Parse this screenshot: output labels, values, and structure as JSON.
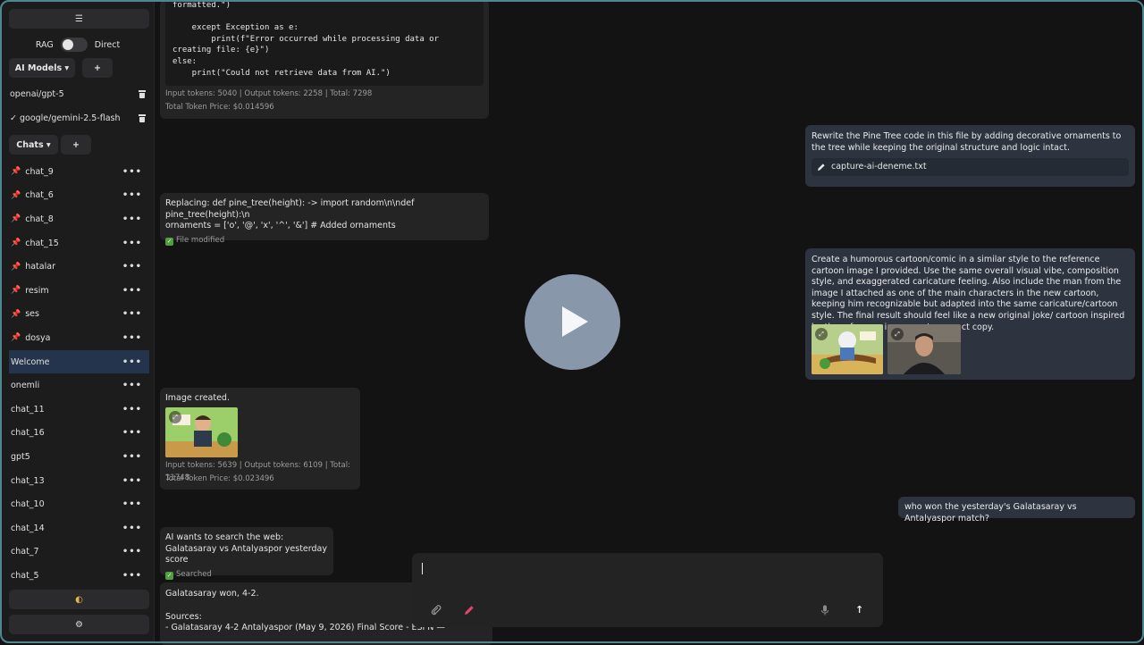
{
  "sidebar": {
    "menu_icon": "☰",
    "toggle_left": "RAG",
    "toggle_right": "Direct",
    "ai_models_label": "AI Models ▾",
    "add_model_label": "+",
    "models": [
      {
        "name": "openai/gpt-5",
        "selected": false
      },
      {
        "name": "✓ google/gemini-2.5-flash",
        "selected": true
      }
    ],
    "chats_label": "Chats ▾",
    "add_chat_label": "+",
    "chats": [
      {
        "name": "chat_9",
        "pinned": true
      },
      {
        "name": "chat_6",
        "pinned": true
      },
      {
        "name": "chat_8",
        "pinned": true
      },
      {
        "name": "chat_15",
        "pinned": true
      },
      {
        "name": "hatalar",
        "pinned": true
      },
      {
        "name": "resim",
        "pinned": true
      },
      {
        "name": "ses",
        "pinned": true
      },
      {
        "name": "dosya",
        "pinned": true
      },
      {
        "name": "Welcome",
        "pinned": false,
        "active": true
      },
      {
        "name": "onemli",
        "pinned": false
      },
      {
        "name": "chat_11",
        "pinned": false
      },
      {
        "name": "chat_16",
        "pinned": false
      },
      {
        "name": "gpt5",
        "pinned": false
      },
      {
        "name": "chat_13",
        "pinned": false
      },
      {
        "name": "chat_10",
        "pinned": false
      },
      {
        "name": "chat_14",
        "pinned": false
      },
      {
        "name": "chat_7",
        "pinned": false
      },
      {
        "name": "chat_5",
        "pinned": false
      }
    ],
    "more_label": "•••",
    "theme_icon": "◐",
    "settings_icon": "⚙"
  },
  "messages": {
    "m1": {
      "code": "formatted.\")\n\n    except Exception as e:\n        print(f\"Error occurred while processing data or\ncreating file: {e}\")\nelse:\n    print(\"Could not retrieve data from AI.\")",
      "tokens": "Input tokens: 5040 | Output tokens: 2258 | Total: 7298",
      "price": "Total Token Price: $0.014596"
    },
    "m2": {
      "text": "Rewrite the Pine Tree code in this file by adding decorative ornaments to the tree while keeping the original structure and logic intact.",
      "attachment": "capture-ai-deneme.txt"
    },
    "m3": {
      "line1": "Replacing: def pine_tree(height):  ->  import random\\n\\ndef pine_tree(height):\\n",
      "line2": "ornaments = ['o', '@', 'x', '^', '&'] # Added ornaments",
      "status": "File modified"
    },
    "m4": {
      "text": "Create a humorous cartoon/comic in a similar style to the reference cartoon image I provided. Use the same overall visual vibe, composition style, and exaggerated caricature feeling. Also include the man from the image I attached as one of the main characters in the new cartoon, keeping him recognizable but adapted into the same caricature/cartoon style. The final result should feel like a new original joke/ cartoon inspired by the reference image, not an exact copy."
    },
    "m5": {
      "text": "Image created.",
      "tokens": "Input tokens: 5639 | Output tokens: 6109 | Total: 11748",
      "price": "Total Token Price: $0.023496"
    },
    "m6": {
      "text": "who won the yesterday's Galatasaray vs Antalyaspor match?"
    },
    "m7": {
      "line1": "AI wants to search the web:",
      "line2": "Galatasaray vs Antalyaspor yesterday score",
      "status": "Searched"
    },
    "m8": {
      "line1": "Galatasaray won, 4-2.",
      "line2": "Sources:",
      "line3": "- Galatasaray 4-2 Antalyaspor (May 9, 2026) Final Score - ESPN —"
    }
  },
  "composer": {
    "input_value": "",
    "attach_icon": "paperclip-icon",
    "draw_icon": "pencil-icon",
    "mic_icon": "microphone-icon",
    "send_icon": "↑"
  },
  "colors": {
    "accent_border": "#4d8791",
    "active_chat": "#24344c",
    "pin": "#e24a5a",
    "user_bubble": "#2d3440"
  }
}
